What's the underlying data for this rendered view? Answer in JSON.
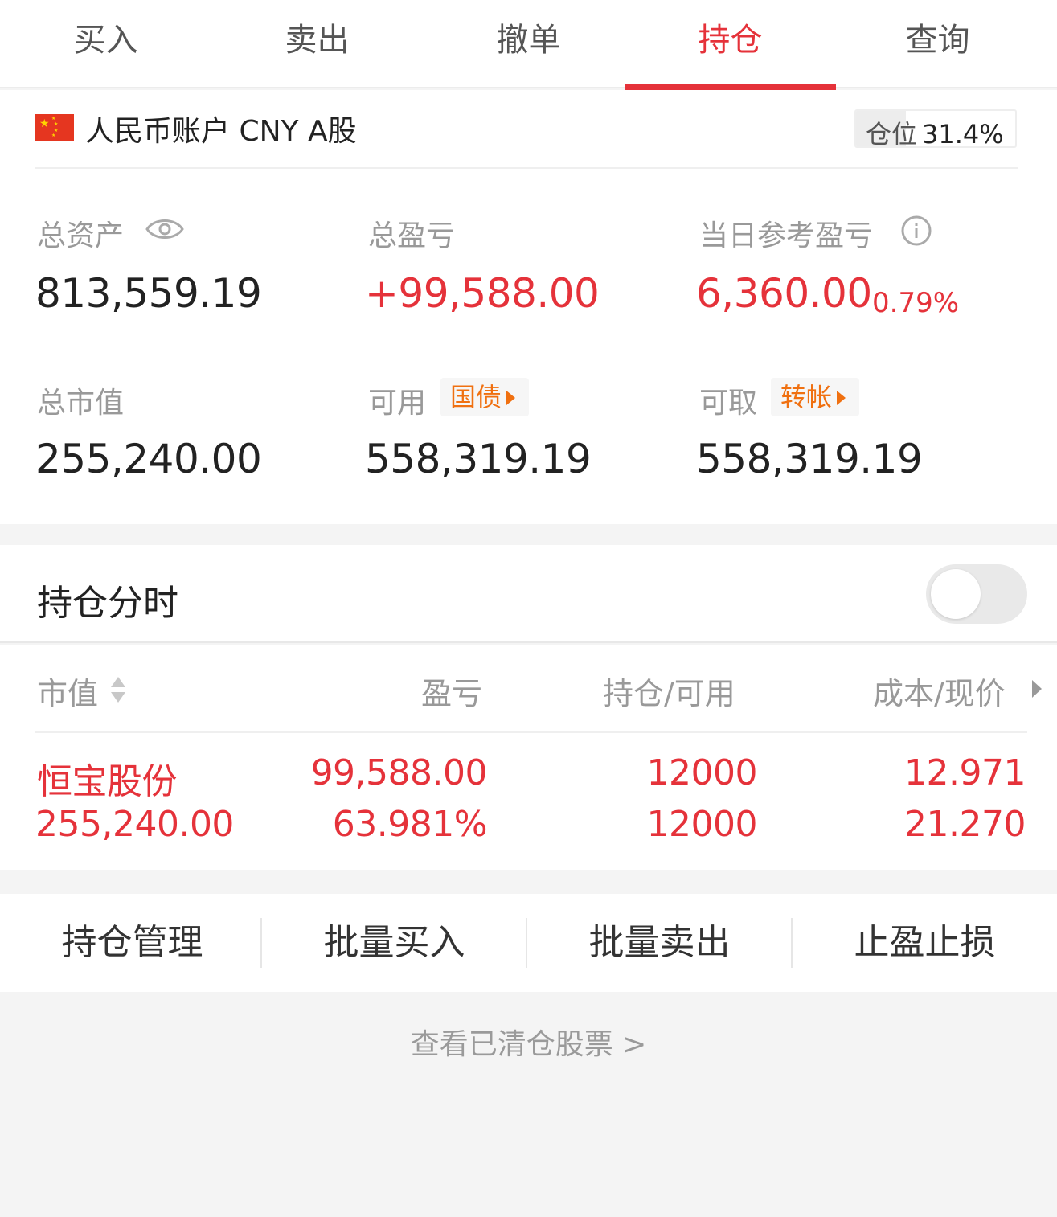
{
  "tabs": [
    {
      "label": "买入"
    },
    {
      "label": "卖出"
    },
    {
      "label": "撤单"
    },
    {
      "label": "持仓",
      "active": true
    },
    {
      "label": "查询"
    }
  ],
  "account": {
    "title": "人民币账户 CNY A股",
    "flag_icon": "china-flag-icon",
    "position_label": "仓位",
    "position_value": "31.4%",
    "position_fraction": 0.314
  },
  "metrics": {
    "total_assets": {
      "label": "总资产",
      "value": "813,559.19",
      "icon": "eye-icon"
    },
    "total_pnl": {
      "label": "总盈亏",
      "value": "+99,588.00"
    },
    "daily_pnl": {
      "label": "当日参考盈亏",
      "value": "6,360.00",
      "percent": "0.79%",
      "icon": "info-icon"
    },
    "market_value": {
      "label": "总市值",
      "value": "255,240.00"
    },
    "available": {
      "label": "可用",
      "value": "558,319.19",
      "tag": "国债"
    },
    "withdrawable": {
      "label": "可取",
      "value": "558,319.19",
      "tag": "转帐"
    }
  },
  "intraday": {
    "label": "持仓分时",
    "enabled": false
  },
  "holdings": {
    "headers": {
      "market_value": "市值",
      "pnl": "盈亏",
      "position": "持仓/可用",
      "cost": "成本/现价"
    },
    "rows": [
      {
        "name": "恒宝股份",
        "market_value": "255,240.00",
        "pnl": "99,588.00",
        "pnl_pct": "63.981%",
        "position": "12000",
        "available": "12000",
        "cost": "12.971",
        "price": "21.270"
      }
    ]
  },
  "actions": [
    "持仓管理",
    "批量买入",
    "批量卖出",
    "止盈止损"
  ],
  "cleared_link": "查看已清仓股票 >",
  "colors": {
    "accent": "#e5323a",
    "tag": "#f07010",
    "muted": "#999999"
  }
}
